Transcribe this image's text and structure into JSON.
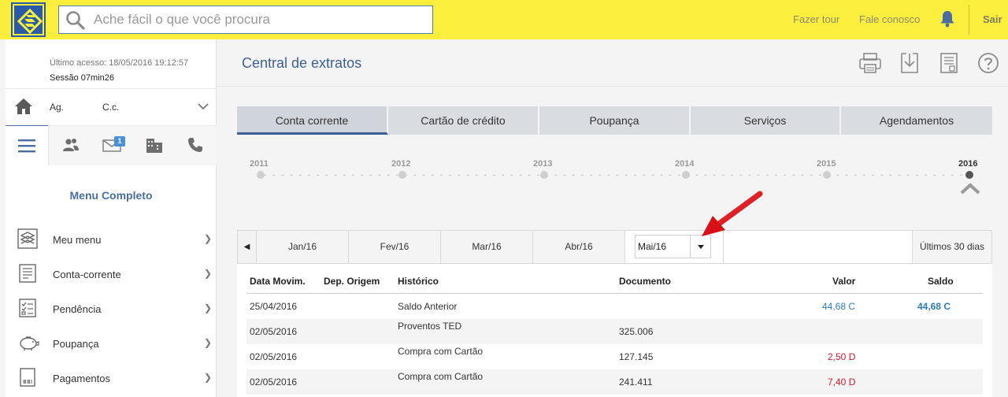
{
  "header": {
    "search_placeholder": "Ache fácil o que você procura",
    "links": [
      "Fazer tour",
      "Fale conosco"
    ],
    "logout_label": "Sair"
  },
  "sidebar": {
    "last_access": "Último acesso: 18/05/2016 19:12:57",
    "session": "Sessão 07min26",
    "ag_label": "Ag.",
    "cc_label": "C.c.",
    "mail_badge": "1",
    "menu_title": "Menu Completo",
    "items": [
      {
        "label": "Meu menu",
        "icon": "my-menu-icon"
      },
      {
        "label": "Conta-corrente",
        "icon": "account-icon"
      },
      {
        "label": "Pendência",
        "icon": "checklist-icon"
      },
      {
        "label": "Poupança",
        "icon": "piggy-bank-icon"
      },
      {
        "label": "Pagamentos",
        "icon": "barcode-icon"
      }
    ]
  },
  "main": {
    "title": "Central de extratos",
    "tabs": [
      "Conta corrente",
      "Cartão de crédito",
      "Poupança",
      "Serviços",
      "Agendamentos"
    ],
    "active_tab": "Conta corrente",
    "years": [
      "2011",
      "2012",
      "2013",
      "2014",
      "2015",
      "2016"
    ],
    "active_year": "2016",
    "months": [
      "Jan/16",
      "Fev/16",
      "Mar/16",
      "Abr/16"
    ],
    "selected_month": "Mai/16",
    "last_days": "Últimos 30 dias",
    "table": {
      "headers": [
        "Data Movim.",
        "Dep. Origem",
        "Histórico",
        "Documento",
        "Valor",
        "Saldo"
      ],
      "rows": [
        {
          "date": "25/04/2016",
          "origin": "",
          "history": "Saldo Anterior",
          "document": "",
          "value": "44,68 C",
          "balance": "44,68 C"
        },
        {
          "date": "02/05/2016",
          "origin": "",
          "history": "Proventos TED",
          "document": "325.006",
          "value": "",
          "balance": ""
        },
        {
          "date": "02/05/2016",
          "origin": "",
          "history": "Compra com Cartão",
          "document": "127.145",
          "value": "2,50 D",
          "balance": ""
        },
        {
          "date": "02/05/2016",
          "origin": "",
          "history": "Compra com Cartão",
          "document": "241.411",
          "value": "7,40 D",
          "balance": ""
        }
      ]
    }
  },
  "colors": {
    "header_yellow": "#fbee3c",
    "brand_blue": "#3d5f94",
    "credit_blue": "#2b7bb9",
    "debit_red": "#d0192b",
    "arrow_red": "#e8161c"
  }
}
